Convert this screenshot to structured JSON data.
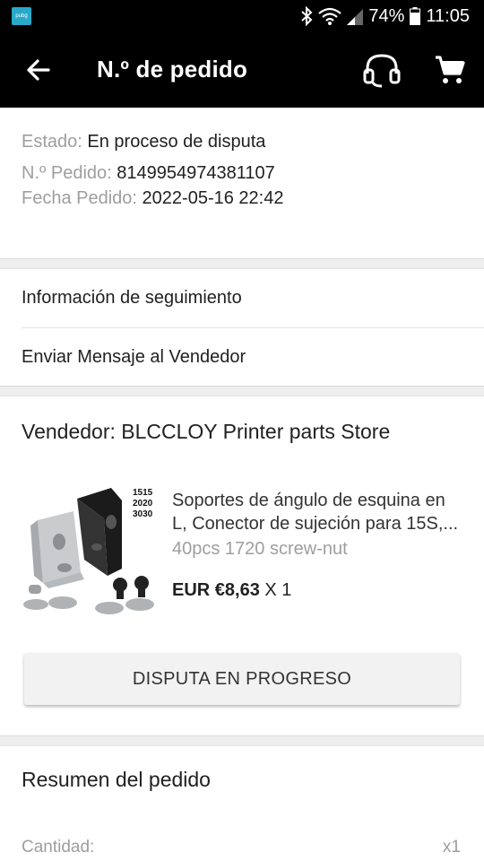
{
  "status_bar": {
    "app_icon_text": "pubg",
    "battery": "74%",
    "time": "11:05",
    "icons": [
      "bluetooth-icon",
      "wifi-icon",
      "signal-icon",
      "battery-icon"
    ]
  },
  "app_bar": {
    "title": "N.º de pedido",
    "icons": [
      "arrow-left-icon",
      "headset-icon",
      "cart-icon"
    ]
  },
  "order": {
    "status_label": "Estado:",
    "status_value": "En proceso de disputa",
    "number_label": "N.º Pedido:",
    "number_value": "8149954974381107",
    "date_label": "Fecha Pedido:",
    "date_value": "2022-05-16 22:42"
  },
  "menu": {
    "tracking": "Información de seguimiento",
    "message_seller": "Enviar Mensaje al Vendedor"
  },
  "seller": {
    "label": "Vendedor: BLCCLOY Printer parts Store"
  },
  "product": {
    "title_line1": "Soportes de ángulo de esquina en",
    "title_line2": "L, Conector de sujeción para 15S,...",
    "variant": "40pcs 1720 screw-nut",
    "price": "EUR €8,63",
    "quantity": "X 1",
    "image_labels": [
      "1515",
      "2020",
      "3030"
    ]
  },
  "dispute_button": "DISPUTA EN PROGRESO",
  "summary": {
    "title": "Resumen del pedido",
    "quantity_label": "Cantidad:",
    "quantity_value": "x1"
  },
  "colors": {
    "bar_bg": "#000000",
    "divider": "#eeeeee",
    "secondary_text": "#9e9e9e",
    "button_bg": "#f2f2f2"
  }
}
